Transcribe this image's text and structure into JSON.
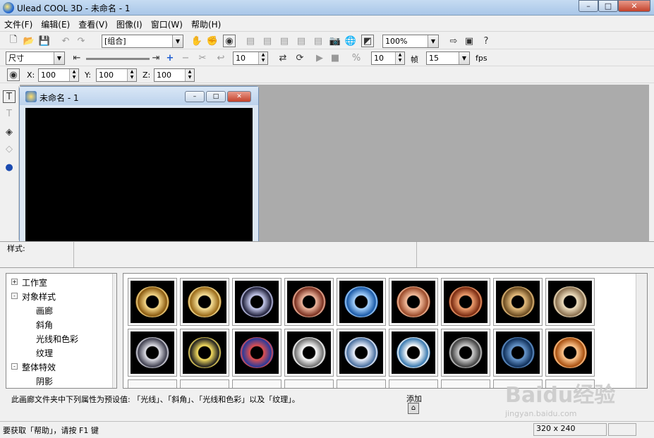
{
  "window": {
    "title": "Ulead COOL 3D - 未命名 - 1",
    "min": "–",
    "max": "□",
    "close": "✕"
  },
  "menu": [
    "文件(F)",
    "编辑(E)",
    "查看(V)",
    "图像(I)",
    "窗口(W)",
    "帮助(H)"
  ],
  "toolbar1": {
    "object_select": "[组合]",
    "zoom": "100%"
  },
  "toolbar2": {
    "size_select": "尺寸",
    "value1": "10",
    "value2": "10",
    "frame_label": "帧",
    "frames": "15",
    "fps": "fps"
  },
  "toolbar3": {
    "x_label": "X:",
    "x": "100",
    "y_label": "Y:",
    "y": "100",
    "z_label": "Z:",
    "z": "100"
  },
  "document": {
    "title": "未命名 - 1"
  },
  "style": {
    "label": "样式:"
  },
  "tree": [
    {
      "label": "工作室",
      "level": 0,
      "toggle": "+"
    },
    {
      "label": "对象样式",
      "level": 0,
      "toggle": "-"
    },
    {
      "label": "画廊",
      "level": 1
    },
    {
      "label": "斜角",
      "level": 1
    },
    {
      "label": "光线和色彩",
      "level": 1
    },
    {
      "label": "纹理",
      "level": 1
    },
    {
      "label": "整体特效",
      "level": 0,
      "toggle": "-"
    },
    {
      "label": "阴影",
      "level": 1
    }
  ],
  "gallery": {
    "thumbs": [
      {
        "c1": "#f7d98a",
        "c2": "#8a5a10"
      },
      {
        "c1": "#f8e29a",
        "c2": "#9a6a18"
      },
      {
        "c1": "#c8ccf0",
        "c2": "#20203a"
      },
      {
        "c1": "#f0b8a0",
        "c2": "#7a3020"
      },
      {
        "c1": "#a8d4ff",
        "c2": "#1a5aa8"
      },
      {
        "c1": "#f6c0a0",
        "c2": "#9a4a2a"
      },
      {
        "c1": "#f0a070",
        "c2": "#7a2a10"
      },
      {
        "c1": "#e8c080",
        "c2": "#6a4a20"
      },
      {
        "c1": "#f0e0c0",
        "c2": "#8a7050"
      },
      {
        "c1": "#e0e0e8",
        "c2": "#404050"
      },
      {
        "c1": "#f8e060",
        "c2": "#202020"
      },
      {
        "c1": "#e05050",
        "c2": "#2a3a9a"
      },
      {
        "c1": "#ffffff",
        "c2": "#707070"
      },
      {
        "c1": "#f0f4ff",
        "c2": "#4a70a0"
      },
      {
        "c1": "#ffffff",
        "c2": "#3a7ab0"
      },
      {
        "c1": "#d0d0d0",
        "c2": "#404040"
      },
      {
        "c1": "#6a9ad0",
        "c2": "#10305a"
      },
      {
        "c1": "#ffc890",
        "c2": "#a85010"
      }
    ]
  },
  "description": {
    "text": "此画廊文件夹中下列属性为预设值: 「光线」、「斜角」、「光线和色彩」以及「纹理」。",
    "add": "添加"
  },
  "status": {
    "text": "要获取「帮助」，请按 F1 键",
    "resolution": "320 x 240"
  },
  "watermark": {
    "brand": "Baidu经验",
    "url": "jingyan.baidu.com"
  }
}
